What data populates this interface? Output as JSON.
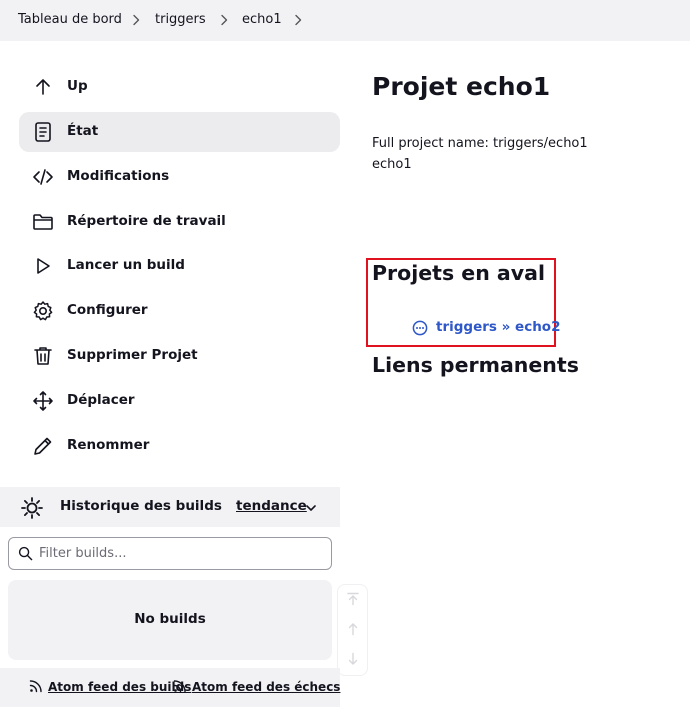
{
  "breadcrumb": {
    "items": [
      "Tableau de bord",
      "triggers",
      "echo1"
    ]
  },
  "sidebar": {
    "items": [
      {
        "label": "Up",
        "icon": "arrow-up-icon"
      },
      {
        "label": "État",
        "icon": "document-icon",
        "active": true
      },
      {
        "label": "Modifications",
        "icon": "code-icon"
      },
      {
        "label": "Répertoire de travail",
        "icon": "folder-icon"
      },
      {
        "label": "Lancer un build",
        "icon": "play-icon"
      },
      {
        "label": "Configurer",
        "icon": "gear-icon"
      },
      {
        "label": "Supprimer Projet",
        "icon": "trash-icon"
      },
      {
        "label": "Déplacer",
        "icon": "move-icon"
      },
      {
        "label": "Renommer",
        "icon": "pencil-icon"
      }
    ]
  },
  "build_history": {
    "title": "Historique des builds",
    "trend_label": "tendance",
    "filter_placeholder": "Filter builds...",
    "empty_text": "No builds",
    "feeds": [
      "Atom feed des builds",
      "Atom feed des échecs"
    ]
  },
  "main": {
    "title": "Projet echo1",
    "full_name": "Full project name: triggers/echo1",
    "description": "echo1",
    "downstream_heading": "Projets en aval",
    "downstream_link": "triggers » echo2",
    "permalinks_heading": "Liens permanents"
  },
  "colors": {
    "link": "#2e57c8",
    "highlight_box": "#e0121f",
    "active_item_bg": "#ececee"
  }
}
